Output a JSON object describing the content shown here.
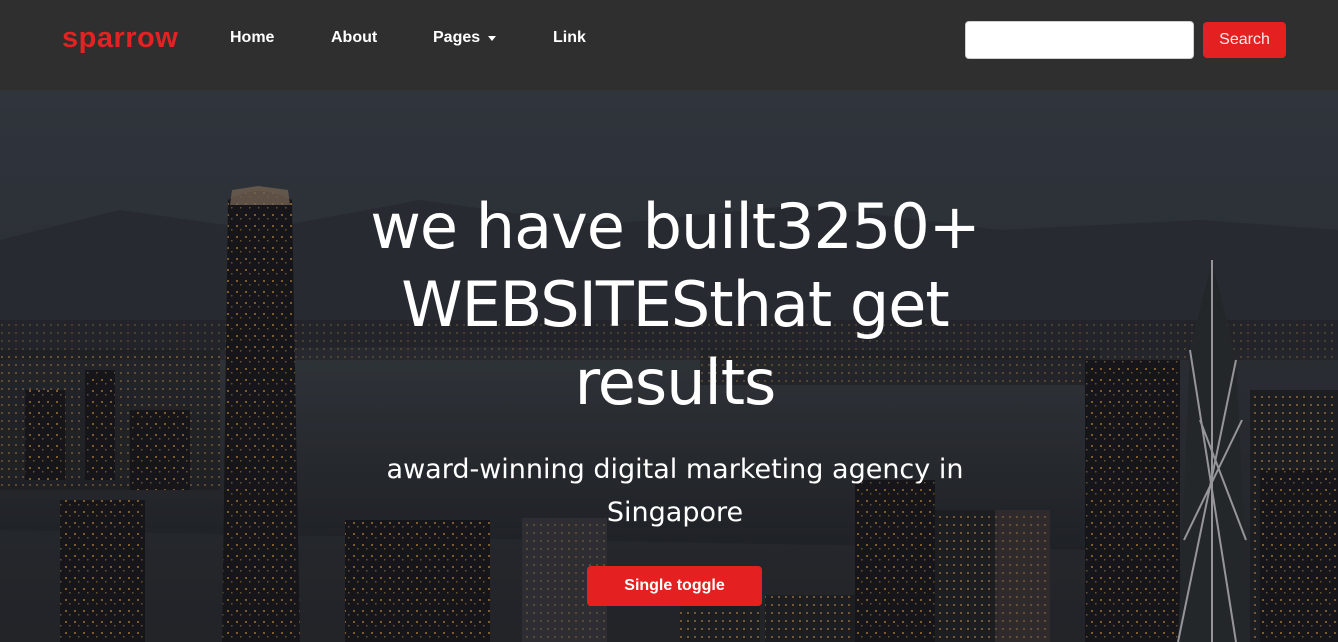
{
  "navbar": {
    "brand": "sparrow",
    "links": [
      {
        "label": "Home"
      },
      {
        "label": "About"
      },
      {
        "label": "Pages"
      },
      {
        "label": "Link"
      }
    ],
    "search": {
      "value": "",
      "placeholder": "",
      "button_label": "Search"
    }
  },
  "hero": {
    "title_line1": "we have built3250+",
    "title_line2": "WEBSITESthat get",
    "title_line3": "results",
    "subtitle_line1": "award-winning digital marketing agency in",
    "subtitle_line2": "Singapore",
    "button_label": "Single toggle"
  },
  "colors": {
    "navbar_bg": "#2f2f2f",
    "brand": "#e32222",
    "accent_button": "#e52020"
  },
  "icons": {
    "pages_dropdown": "caret-down-icon"
  }
}
